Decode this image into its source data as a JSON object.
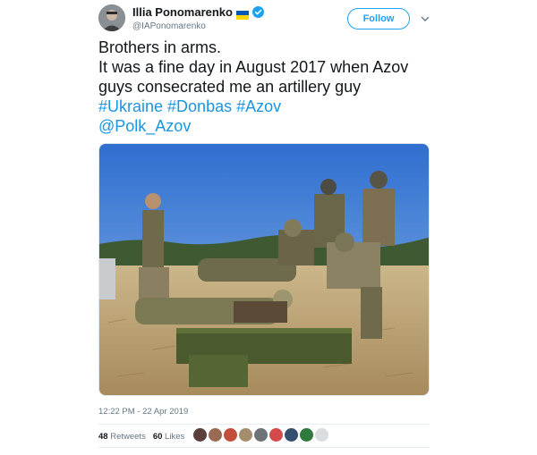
{
  "header": {
    "display_name": "Illia Ponomarenko",
    "handle": "@IAPonomarenko",
    "follow_label": "Follow"
  },
  "tweet": {
    "line1": "Brothers in arms.",
    "line2": "It was a fine day in August 2017 when Azov",
    "line3": "guys consecrated me an artillery guy",
    "hashtags": "#Ukraine #Donbas #Azov",
    "mention": "@Polk_Azov"
  },
  "meta": {
    "timestamp": "12:22 PM - 22 Apr 2019",
    "retweets_count": "48",
    "retweets_label": "Retweets",
    "likes_count": "60",
    "likes_label": "Likes"
  },
  "colors": {
    "link": "#1b95e0",
    "follow_border": "#1da1f2",
    "muted": "#657786"
  },
  "icons": {
    "flag": "ukraine-flag-icon",
    "verified": "verified-badge-icon",
    "caret": "chevron-down-icon"
  }
}
